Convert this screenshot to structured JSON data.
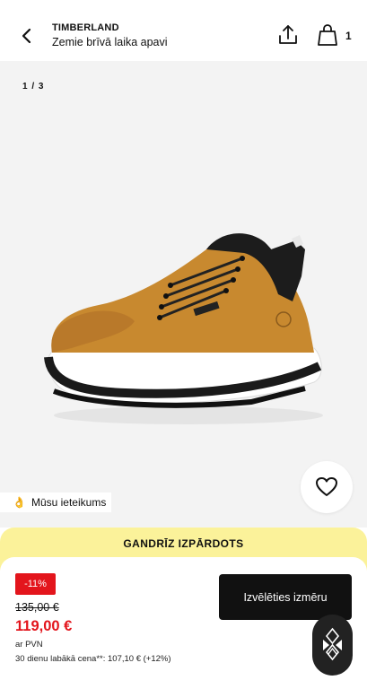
{
  "header": {
    "brand": "TIMBERLAND",
    "subtitle": "Zemie brīvā laika apavi",
    "bag_count": "1",
    "icons": {
      "back": "chevron-left-icon",
      "share": "share-icon",
      "bag": "shopping-bag-icon"
    }
  },
  "gallery": {
    "page_indicator": "1 / 3",
    "recommendation_emoji": "👌",
    "recommendation_label": "Mūsu ieteikums",
    "favorite_icon": "heart-icon"
  },
  "banner": {
    "text": "GANDRĪZ IZPĀRDOTS"
  },
  "pricing": {
    "discount": "-11%",
    "old_price": "135,00 €",
    "new_price": "119,00 €",
    "vat_note": "ar PVN",
    "best_price_note": "30 dienu labākā cena**: 107,10 € (+12%)",
    "size_button_label": "Izvēlēties izmēru",
    "assistant_icon": "assistant-logo-icon"
  },
  "colors": {
    "accent_red": "#e3151c",
    "banner_yellow": "#fbf29a",
    "primary_black": "#111111",
    "gallery_bg": "#f3f3f3"
  }
}
